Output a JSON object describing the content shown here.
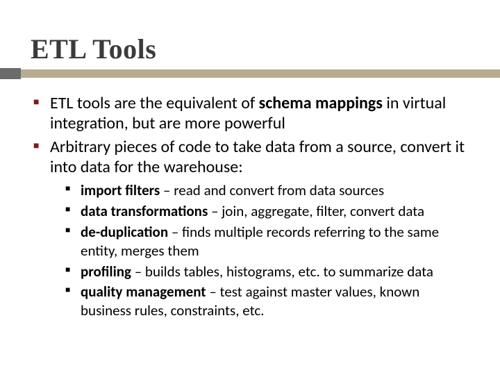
{
  "title": "ETL Tools",
  "bullets": {
    "b1_pre": "ETL tools are the equivalent of ",
    "b1_bold": "schema mappings",
    "b1_post": " in virtual integration, but are more powerful",
    "b2": "Arbitrary pieces of code to take data from a source, convert it into data for the warehouse:",
    "sub": {
      "s1_bold": "import filters",
      "s1_rest": " – read and convert from data sources",
      "s2_bold": "data transformations",
      "s2_rest": " – join, aggregate, filter, convert data",
      "s3_bold": "de-duplication",
      "s3_rest": " – finds multiple records referring to the same entity, merges them",
      "s4_bold": "profiling",
      "s4_rest": " – builds tables, histograms, etc. to summarize data",
      "s5_bold": "quality management",
      "s5_rest": " – test against master values, known business rules, constraints, etc."
    }
  }
}
